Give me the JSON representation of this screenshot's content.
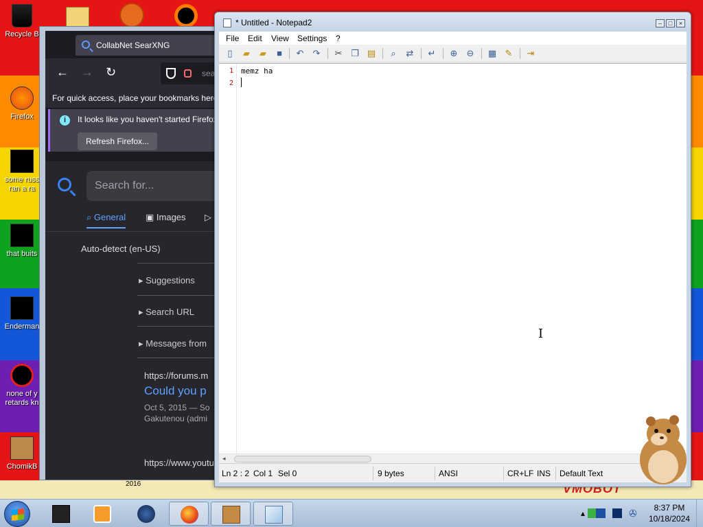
{
  "desktop": {
    "icons": [
      {
        "label": "Recycle B",
        "icon": "recycle-bin-icon"
      },
      {
        "label": "Firefox",
        "icon": "firefox-icon"
      },
      {
        "label": "some russ",
        "label2": "ran a ra",
        "icon": "document-icon"
      },
      {
        "label": "that buits",
        "icon": "folder-icon"
      },
      {
        "label": "Enderman",
        "icon": "program-icon"
      },
      {
        "label": "none of y",
        "label2": "retards kn",
        "icon": "opera-icon"
      },
      {
        "label": "ChomikB",
        "icon": "hamster-icon"
      }
    ]
  },
  "firefox": {
    "tab_title": "CollabNet SearXNG",
    "url_text": "sea",
    "bookmarks_text": "For quick access, place your bookmarks here",
    "notice_text": "It looks like you haven't started Firefox",
    "refresh_button": "Refresh Firefox...",
    "search_placeholder": "Search for...",
    "tabs": [
      "General",
      "Images"
    ],
    "language": "Auto-detect (en-US)",
    "sidebar_items": [
      "Suggestions",
      "Search URL",
      "Messages from"
    ],
    "result": {
      "url": "https://forums.m",
      "title": "Could you p",
      "date": "Oct 5, 2015 — So",
      "author": "Gakutenou (admi",
      "url2": "https://www.youtu"
    }
  },
  "notepad": {
    "title": "* Untitled - Notepad2",
    "menu": [
      "File",
      "Edit",
      "View",
      "Settings",
      "?"
    ],
    "lines": [
      {
        "num": "1",
        "text": "memz ha"
      },
      {
        "num": "2",
        "text": ""
      }
    ],
    "status": {
      "position": "Ln 2 : 2",
      "col": "Col 1",
      "sel": "Sel 0",
      "size": "9 bytes",
      "encoding": "ANSI",
      "eol": "CR+LF",
      "mode": "INS",
      "scheme": "Default Text"
    }
  },
  "taskbar": {
    "time": "8:37 PM",
    "date": "10/18/2024",
    "buttons": [
      "file-manager",
      "media-player",
      "globe",
      "firefox",
      "chomik-box",
      "notepad2"
    ]
  },
  "decor": {
    "year_text": "2016",
    "banner_text": "VMOBOT"
  },
  "colors": {
    "accent": "#5ea1ff",
    "line_numbers": "#bb0000"
  }
}
